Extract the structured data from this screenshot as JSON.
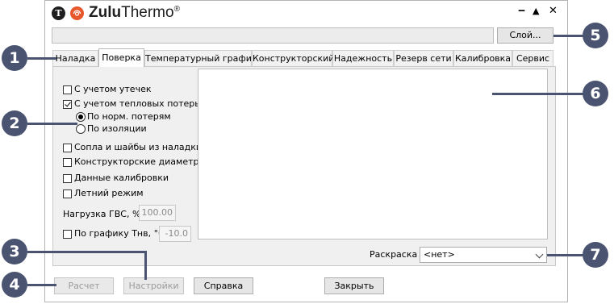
{
  "app": {
    "logo_letter": "T",
    "title_bold": "Zulu",
    "title_rest": "Thermo",
    "title_mark": "®",
    "window_controls": [
      "‒",
      "▲",
      "✕"
    ]
  },
  "toolbar": {
    "layer_button": "Слой..."
  },
  "tabs": [
    {
      "label": "Наладка",
      "active": false
    },
    {
      "label": "Поверка",
      "active": true
    },
    {
      "label": "Температурный график",
      "active": false
    },
    {
      "label": "Конструкторский",
      "active": false
    },
    {
      "label": "Надежность",
      "active": false
    },
    {
      "label": "Резерв сети",
      "active": false
    },
    {
      "label": "Калибровка",
      "active": false
    },
    {
      "label": "Сервис",
      "active": false
    }
  ],
  "options": {
    "leaks": {
      "label": "С учетом утечек",
      "checked": false
    },
    "heat_loss": {
      "label": "С учетом тепловых потерь",
      "checked": true
    },
    "radio_norm": {
      "label": "По норм. потерям",
      "checked": true
    },
    "radio_insulation": {
      "label": "По изоляции",
      "checked": false
    },
    "nozzles": {
      "label": "Сопла и шайбы из наладки",
      "checked": false
    },
    "design_diameters": {
      "label": "Конструкторские диаметры",
      "checked": false
    },
    "calibration_data": {
      "label": "Данные калибровки",
      "checked": false
    },
    "summer_mode": {
      "label": "Летний режим",
      "checked": false
    },
    "dhw_load_label": "Нагрузка ГВС, %",
    "dhw_load_value": "100.00",
    "by_schedule": {
      "label": "По графику Тнв, °C",
      "checked": false
    },
    "schedule_value": "-10.0"
  },
  "coloring": {
    "label": "Раскраска",
    "value": "<нет>"
  },
  "footer": {
    "calc": "Расчет",
    "settings": "Настройки",
    "help": "Справка",
    "close": "Закрыть"
  },
  "callouts": [
    "1",
    "2",
    "3",
    "4",
    "5",
    "6",
    "7"
  ],
  "colors": {
    "callout": "#4a5370",
    "logo_red": "#e8572b"
  }
}
